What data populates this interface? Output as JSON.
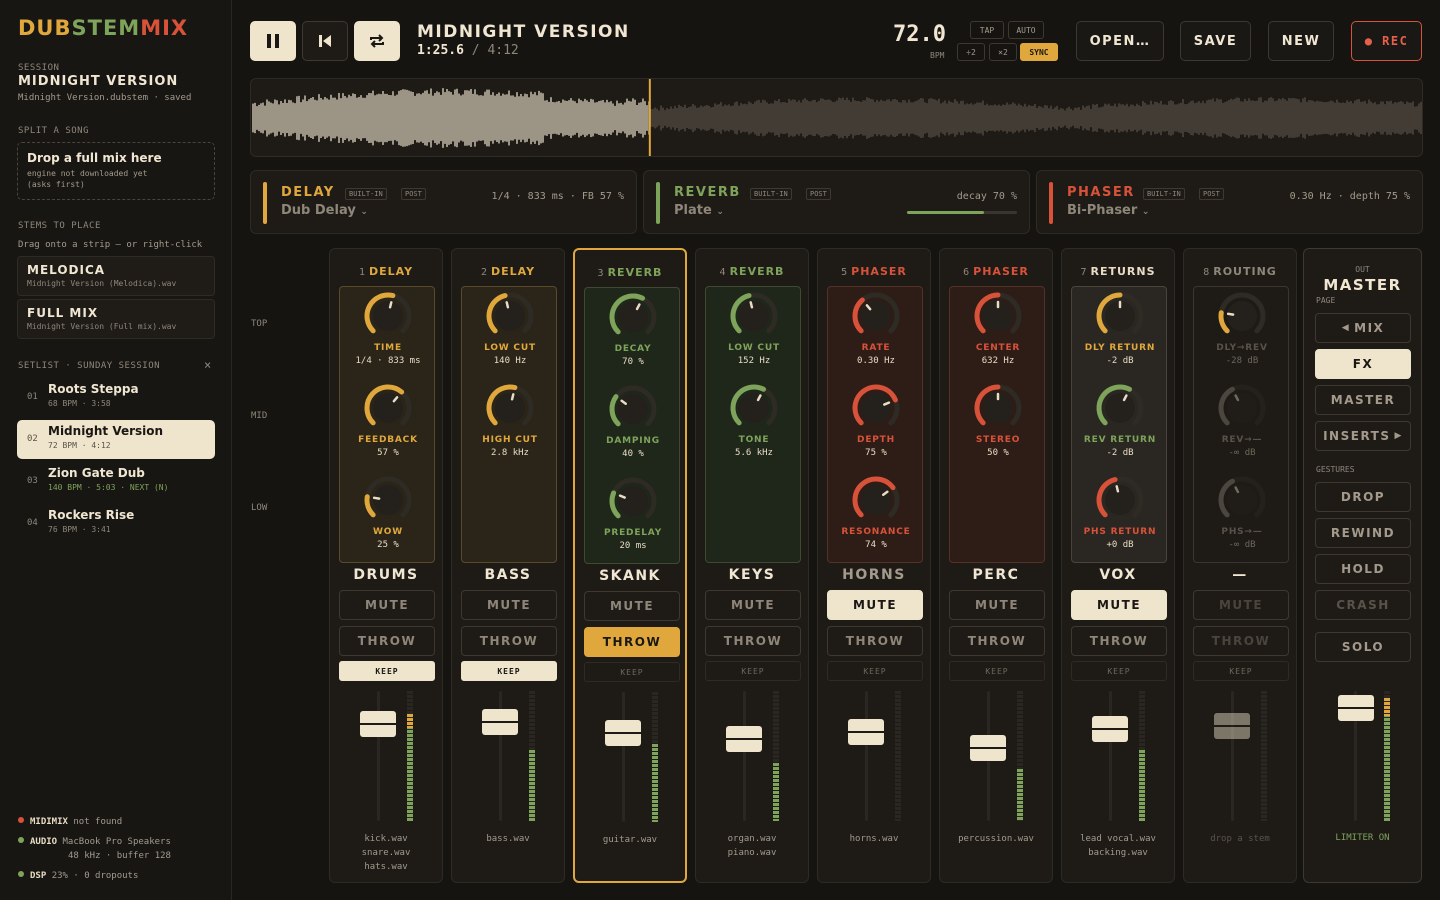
{
  "app": {
    "logo": "DUBSTEMMIX"
  },
  "sidebar": {
    "session_label": "SESSION",
    "session_title": "MIDNIGHT VERSION",
    "session_file": "Midnight Version.dubstem · saved",
    "split_label": "SPLIT A SONG",
    "drop_title": "Drop a full mix here",
    "drop_sub1": "engine not downloaded yet",
    "drop_sub2": "(asks first)",
    "stems_label": "STEMS TO PLACE",
    "stems_hint": "Drag onto a strip — or right-click",
    "stems": [
      {
        "title": "MELODICA",
        "file": "Midnight Version (Melodica).wav"
      },
      {
        "title": "FULL MIX",
        "file": "Midnight Version (Full mix).wav"
      }
    ],
    "setlist_label": "SETLIST · SUNDAY SESSION",
    "setlist_close": "×",
    "songs": [
      {
        "num": "01",
        "title": "Roots Steppa",
        "meta": "68 BPM · 3:58"
      },
      {
        "num": "02",
        "title": "Midnight Version",
        "meta": "72 BPM · 4:12"
      },
      {
        "num": "03",
        "title": "Zion Gate Dub",
        "meta": "140 BPM · 5:03 · NEXT (N)"
      },
      {
        "num": "04",
        "title": "Rockers Rise",
        "meta": "76 BPM · 3:41"
      }
    ],
    "status": {
      "midi_name": "MIDIMIX",
      "midi_val": "not found",
      "audio_name": "AUDIO",
      "audio_val": "MacBook Pro Speakers",
      "audio_val2": "48 kHz · buffer 128",
      "dsp_name": "DSP",
      "dsp_val": "23% · 0 dropouts"
    },
    "colors": {
      "red": "#d8523a",
      "green": "#7ea35a"
    }
  },
  "transport": {
    "title": "MIDNIGHT VERSION",
    "time": "1:25.6",
    "sep": "/",
    "duration": "4:12",
    "bpm": "72.0",
    "bpm_label": "BPM",
    "tap": "TAP",
    "auto": "AUTO",
    "half": "÷2",
    "double": "×2",
    "sync": "SYNC",
    "open": "OPEN…",
    "save": "SAVE",
    "new": "NEW",
    "rec": "● REC",
    "progress": 0.34
  },
  "fx": [
    {
      "name": "DELAY",
      "preset": "Dub Delay",
      "tag1": "BUILT-IN",
      "tag2": "POST",
      "params": "1/4 · 833 ms · FB 57 %",
      "color": "#e0a83c"
    },
    {
      "name": "REVERB",
      "preset": "Plate",
      "tag1": "BUILT-IN",
      "tag2": "POST",
      "params": "decay 70 %",
      "color": "#7ea35a",
      "level": 0.7
    },
    {
      "name": "PHASER",
      "preset": "Bi-Phaser",
      "tag1": "BUILT-IN",
      "tag2": "POST",
      "params": "0.30 Hz · depth 75 %",
      "color": "#d8523a"
    }
  ],
  "rows": {
    "top": "TOP",
    "mid": "MID",
    "low": "LOW"
  },
  "channels": [
    {
      "num": "1",
      "fx": "DELAY",
      "name": "DRUMS",
      "mute": "MUTE",
      "throw": "THROW",
      "keep": "KEEP",
      "knobs": [
        {
          "label": "TIME",
          "value": "1/4 · 833 ms"
        },
        {
          "label": "FEEDBACK",
          "value": "57 %"
        },
        {
          "label": "WOW",
          "value": "25 %"
        }
      ],
      "files": [
        "kick.wav",
        "snare.wav",
        "hats.wav"
      ]
    },
    {
      "num": "2",
      "fx": "DELAY",
      "name": "BASS",
      "mute": "MUTE",
      "throw": "THROW",
      "keep": "KEEP",
      "knobs": [
        {
          "label": "LOW CUT",
          "value": "140 Hz"
        },
        {
          "label": "HIGH CUT",
          "value": "2.8 kHz"
        }
      ],
      "files": [
        "bass.wav"
      ]
    },
    {
      "num": "3",
      "fx": "REVERB",
      "name": "SKANK",
      "mute": "MUTE",
      "throw": "THROW",
      "keep": "KEEP",
      "knobs": [
        {
          "label": "DECAY",
          "value": "70 %"
        },
        {
          "label": "DAMPING",
          "value": "40 %"
        },
        {
          "label": "PREDELAY",
          "value": "20 ms"
        }
      ],
      "files": [
        "guitar.wav"
      ]
    },
    {
      "num": "4",
      "fx": "REVERB",
      "name": "KEYS",
      "mute": "MUTE",
      "throw": "THROW",
      "keep": "KEEP",
      "knobs": [
        {
          "label": "LOW CUT",
          "value": "152 Hz"
        },
        {
          "label": "TONE",
          "value": "5.6 kHz"
        }
      ],
      "files": [
        "organ.wav",
        "piano.wav"
      ]
    },
    {
      "num": "5",
      "fx": "PHASER",
      "name": "HORNS",
      "mute": "MUTE",
      "throw": "THROW",
      "keep": "KEEP",
      "knobs": [
        {
          "label": "RATE",
          "value": "0.30 Hz"
        },
        {
          "label": "DEPTH",
          "value": "75 %"
        },
        {
          "label": "RESONANCE",
          "value": "74 %"
        }
      ],
      "files": [
        "horns.wav"
      ]
    },
    {
      "num": "6",
      "fx": "PHASER",
      "name": "PERC",
      "mute": "MUTE",
      "throw": "THROW",
      "keep": "KEEP",
      "knobs": [
        {
          "label": "CENTER",
          "value": "632 Hz"
        },
        {
          "label": "STEREO",
          "value": "50 %"
        }
      ],
      "files": [
        "percussion.wav"
      ]
    },
    {
      "num": "7",
      "fx": "RETURNS",
      "name": "VOX",
      "mute": "MUTE",
      "throw": "THROW",
      "keep": "KEEP",
      "knobs": [
        {
          "label": "DLY RETURN",
          "value": "-2 dB"
        },
        {
          "label": "REV RETURN",
          "value": "-2 dB"
        },
        {
          "label": "PHS RETURN",
          "value": "+0 dB"
        }
      ],
      "files": [
        "lead vocal.wav",
        "backing.wav"
      ]
    },
    {
      "num": "8",
      "fx": "ROUTING",
      "name": "—",
      "mute": "MUTE",
      "throw": "THROW",
      "keep": "KEEP",
      "knobs": [
        {
          "label": "DLY→REV",
          "value": "-28 dB"
        },
        {
          "label": "REV→—",
          "value": "-∞ dB"
        },
        {
          "label": "PHS→—",
          "value": "-∞ dB"
        }
      ],
      "files": [
        "drop a stem"
      ]
    }
  ],
  "master": {
    "out": "OUT",
    "title": "MASTER",
    "page": "PAGE",
    "mix": "MIX",
    "fx": "FX",
    "master": "MASTER",
    "inserts": "INSERTS",
    "gestures": "GESTURES",
    "drop": "DROP",
    "rewind": "REWIND",
    "hold": "HOLD",
    "crash": "CRASH",
    "solo": "SOLO",
    "limiter": "LIMITER ON"
  }
}
